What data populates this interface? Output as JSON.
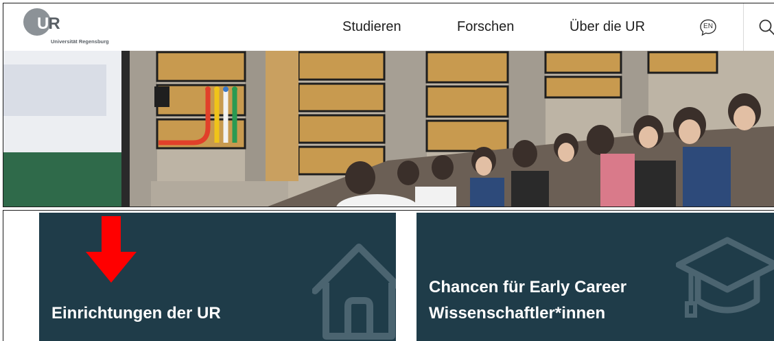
{
  "header": {
    "logo": {
      "mark": "UR",
      "subtitle": "Universität Regensburg"
    },
    "nav": [
      {
        "label": "Studieren"
      },
      {
        "label": "Forschen"
      },
      {
        "label": "Über die UR"
      }
    ],
    "language_button": {
      "label": "EN"
    },
    "search_icon": "search-icon"
  },
  "hero": {
    "icon": "lecture-hall-photo"
  },
  "cards": [
    {
      "title_line1": "Einrichtungen der UR",
      "title_line2": "",
      "icon": "house-icon"
    },
    {
      "title_line1": "Chancen für Early Career",
      "title_line2": "Wissenschaftler*innen",
      "icon": "graduation-cap-icon"
    }
  ],
  "annotation": {
    "icon": "red-arrow-down-icon",
    "color": "#ff0000"
  },
  "colors": {
    "card_background": "#1f3c49",
    "card_text": "#ffffff",
    "nav_text": "#1e1e1e",
    "logo_gray": "#8c9297"
  }
}
